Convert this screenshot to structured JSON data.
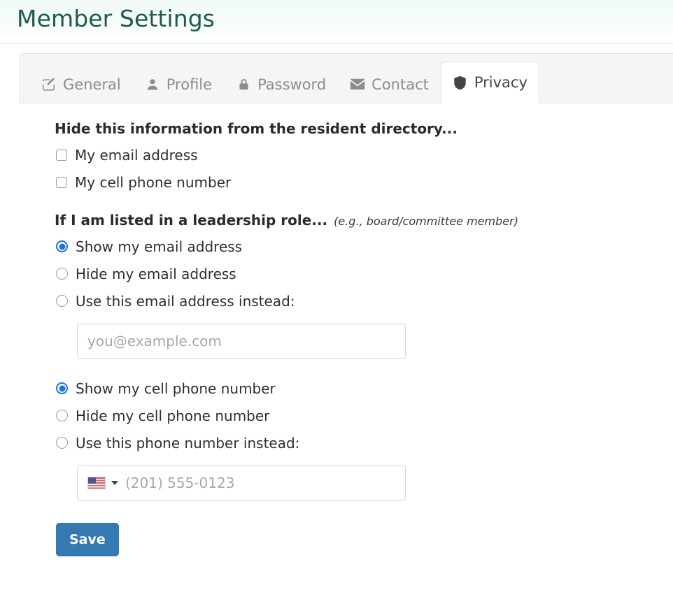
{
  "header": {
    "title": "Member Settings",
    "title_color": "#1c5c49"
  },
  "tabs": [
    {
      "label": "General",
      "icon": "edit-square-icon",
      "active": false
    },
    {
      "label": "Profile",
      "icon": "user-icon",
      "active": false
    },
    {
      "label": "Password",
      "icon": "lock-icon",
      "active": false
    },
    {
      "label": "Contact",
      "icon": "envelope-icon",
      "active": false
    },
    {
      "label": "Privacy",
      "icon": "shield-icon",
      "active": true
    }
  ],
  "privacy": {
    "hide_section": {
      "heading": "Hide this information from the resident directory...",
      "options": [
        {
          "label": "My email address",
          "checked": false
        },
        {
          "label": "My cell phone number",
          "checked": false
        }
      ]
    },
    "leadership_section": {
      "heading": "If I am listed in a leadership role...",
      "note": "(e.g., board/committee member)",
      "email_options": [
        {
          "label": "Show my email address",
          "selected": true
        },
        {
          "label": "Hide my email address",
          "selected": false
        },
        {
          "label": "Use this email address instead:",
          "selected": false
        }
      ],
      "email_input": {
        "value": "",
        "placeholder": "you@example.com"
      },
      "phone_options": [
        {
          "label": "Show my cell phone number",
          "selected": true
        },
        {
          "label": "Hide my cell phone number",
          "selected": false
        },
        {
          "label": "Use this phone number instead:",
          "selected": false
        }
      ],
      "phone_input": {
        "value": "",
        "placeholder": "(201) 555-0123",
        "country_flag": "us-flag-icon"
      }
    },
    "save_label": "Save",
    "save_color": "#3479b0",
    "accent_color": "#1775e0"
  }
}
